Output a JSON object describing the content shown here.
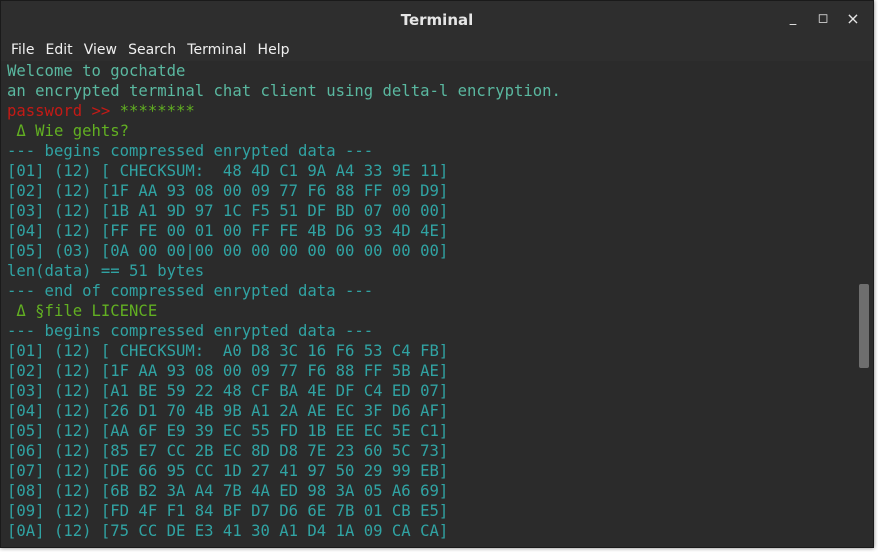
{
  "window": {
    "title": "Terminal",
    "minimize_label": "_",
    "maximize_label": "◻",
    "close_label": "×"
  },
  "menu": [
    "File",
    "Edit",
    "View",
    "Search",
    "Terminal",
    "Help"
  ],
  "colors": {
    "greeting": "#5ab8a0",
    "data": "#30a3a3",
    "prompt": "#c41a16",
    "message": "#62b022"
  },
  "terminal": {
    "lines": [
      "Welcome to gochatde",
      "an encrypted terminal chat client using delta-l encryption.",
      "password >> ",
      "********",
      " Δ Wie gehts?",
      "--- begins compressed enrypted data ---",
      "[01] (12) [ CHECKSUM:  48 4D C1 9A A4 33 9E 11]",
      "[02] (12) [1F AA 93 08 00 09 77 F6 88 FF 09 D9]",
      "[03] (12) [1B A1 9D 97 1C F5 51 DF BD 07 00 00]",
      "[04] (12) [FF FE 00 01 00 FF FE 4B D6 93 4D 4E]",
      "[05] (03) [0A 00 00|00 00 00 00 00 00 00 00 00]",
      "len(data) == 51 bytes",
      "--- end of compressed enrypted data ---",
      " Δ §file LICENCE",
      "--- begins compressed enrypted data ---",
      "[01] (12) [ CHECKSUM:  A0 D8 3C 16 F6 53 C4 FB]",
      "[02] (12) [1F AA 93 08 00 09 77 F6 88 FF 5B AE]",
      "[03] (12) [A1 BE 59 22 48 CF BA 4E DF C4 ED 07]",
      "[04] (12) [26 D1 70 4B 9B A1 2A AE EC 3F D6 AF]",
      "[05] (12) [AA 6F E9 39 EC 55 FD 1B EE EC 5E C1]",
      "[06] (12) [85 E7 CC 2B EC 8D D8 7E 23 60 5C 73]",
      "[07] (12) [DE 66 95 CC 1D 27 41 97 50 29 99 EB]",
      "[08] (12) [6B B2 3A A4 7B 4A ED 98 3A 05 A6 69]",
      "[09] (12) [FD 4F F1 84 BF D7 D6 6E 7B 01 CB E5]",
      "[0A] (12) [75 CC DE E3 41 30 A1 D4 1A 09 CA CA]"
    ]
  }
}
